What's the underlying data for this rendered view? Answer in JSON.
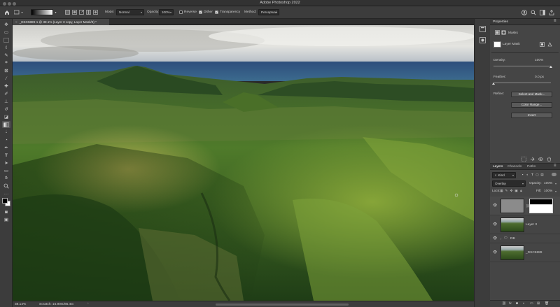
{
  "app": {
    "title": "Adobe Photoshop 2022"
  },
  "options_bar": {
    "mode_label": "Mode:",
    "mode_value": "Normal",
    "opacity_label": "Opacity:",
    "opacity_value": "100%",
    "reverse_label": "Reverse",
    "reverse_checked": false,
    "dither_label": "Dither",
    "dither_checked": true,
    "transparency_label": "Transparency",
    "transparency_checked": true,
    "method_label": "Method:",
    "method_value": "Perceptual"
  },
  "document": {
    "tab_label": "_DSC5889-1 @ 38.1% (Layer 3 copy, Layer Mask/8) *",
    "zoom": "38.14%",
    "scratch": "Scratch: 15.90G/85.4G"
  },
  "properties": {
    "tab_label": "Properties",
    "masks_label": "Masks",
    "layer_mask_label": "Layer Mask",
    "density_label": "Density:",
    "density_value": "100%",
    "density_fraction": 1.0,
    "feather_label": "Feather:",
    "feather_value": "0.0 px",
    "feather_fraction": 0.0,
    "refine_label": "Refine:",
    "select_mask_button": "Select and Mask...",
    "color_range_button": "Color Range...",
    "invert_button": "Invert"
  },
  "layers_panel": {
    "tabs": [
      "Layers",
      "Channels",
      "Paths"
    ],
    "kind_value": "Kind",
    "blend_mode_value": "Overlay",
    "opacity_label": "Opacity:",
    "opacity_value": "100%",
    "lock_label": "Lock:",
    "fill_label": "Fill:",
    "fill_value": "100%",
    "layers": [
      {
        "name": "",
        "type": "adjustment-with-mask",
        "visible": true,
        "selected": false
      },
      {
        "name": "Layer 3",
        "type": "image",
        "visible": true,
        "selected": false
      },
      {
        "name": "DB",
        "type": "group",
        "visible": true,
        "selected": false
      },
      {
        "name": "_DSC5889",
        "type": "image",
        "visible": true,
        "selected": false
      }
    ]
  },
  "colors": {
    "ui_dark": "#323232",
    "ui_panel": "#454545",
    "ui_bar": "#3c3c3c",
    "canvas_bg": "#2a2a2a"
  },
  "icons": {
    "home": "home-icon",
    "search": "search-icon",
    "share": "share-icon",
    "user": "user-icon"
  }
}
